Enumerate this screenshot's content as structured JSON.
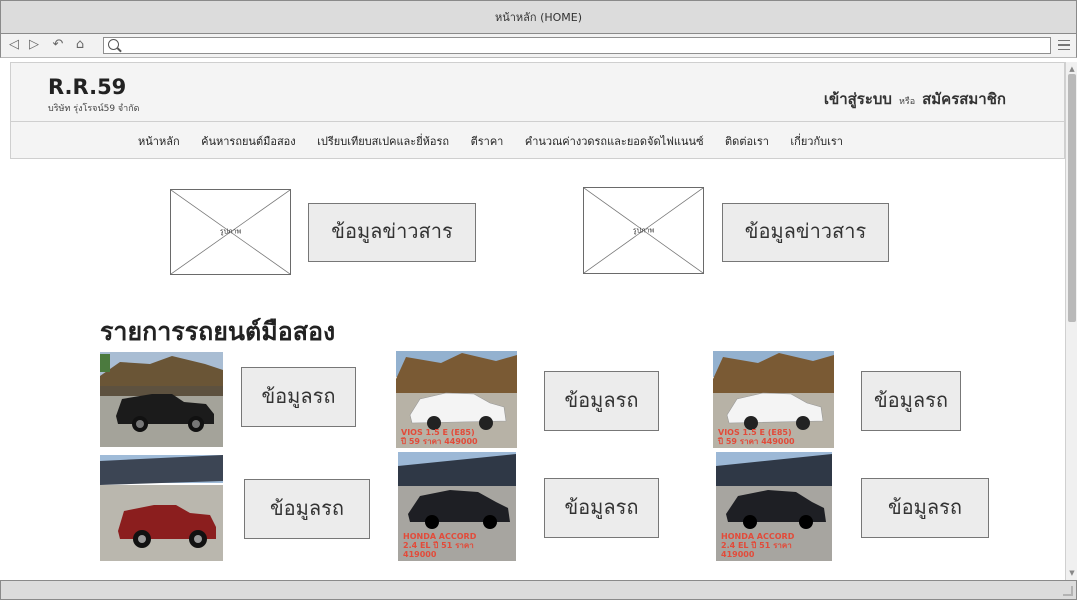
{
  "window": {
    "title": "หน้าหลัก (HOME)"
  },
  "browser": {
    "url": ""
  },
  "header": {
    "logo": "R.R.59",
    "company": "บริษัท รุ่งโรจน์59 จำกัด",
    "login": "เข้าสู่ระบบ",
    "or": "หรือ",
    "register": "สมัครสมาชิก"
  },
  "nav": {
    "items": [
      "หน้าหลัก",
      "ค้นหารถยนต์มือสอง",
      "เปรียบเทียบสเปคและยี่ห้อรถ",
      "ตีราคา",
      "คำนวณค่างวดรถและยอดจัดไฟแนนซ์",
      "ติดต่อเรา",
      "เกี่ยวกับเรา"
    ]
  },
  "news": [
    {
      "image_label": "รูปภาพ",
      "button": "ข้อมูลข่าวสาร"
    },
    {
      "image_label": "รูปภาพ",
      "button": "ข้อมูลข่าวสาร"
    }
  ],
  "cars_title": "รายการรถยนต์มือสอง",
  "cars": [
    {
      "button": "ข้อมูลรถ",
      "caption": "",
      "color": "#1b1b1b"
    },
    {
      "button": "ข้อมูลรถ",
      "caption": "VIOS 1.5 E (E85)\nปี 59 ราคา 449000",
      "color": "#f4f4f4"
    },
    {
      "button": "ข้อมูลรถ",
      "caption": "VIOS 1.5 E (E85)\nปี 59 ราคา 449000",
      "color": "#f4f4f4"
    },
    {
      "button": "ข้อมูลรถ",
      "caption": "",
      "color": "#8b1e1e"
    },
    {
      "button": "ข้อมูลรถ",
      "caption": "HONDA ACCORD\n2.4 EL ปี 51 ราคา\n419000",
      "color": "#1e1f24"
    },
    {
      "button": "ข้อมูลรถ",
      "caption": "HONDA ACCORD\n2.4 EL ปี 51 ราคา\n419000",
      "color": "#1e1f24"
    }
  ]
}
